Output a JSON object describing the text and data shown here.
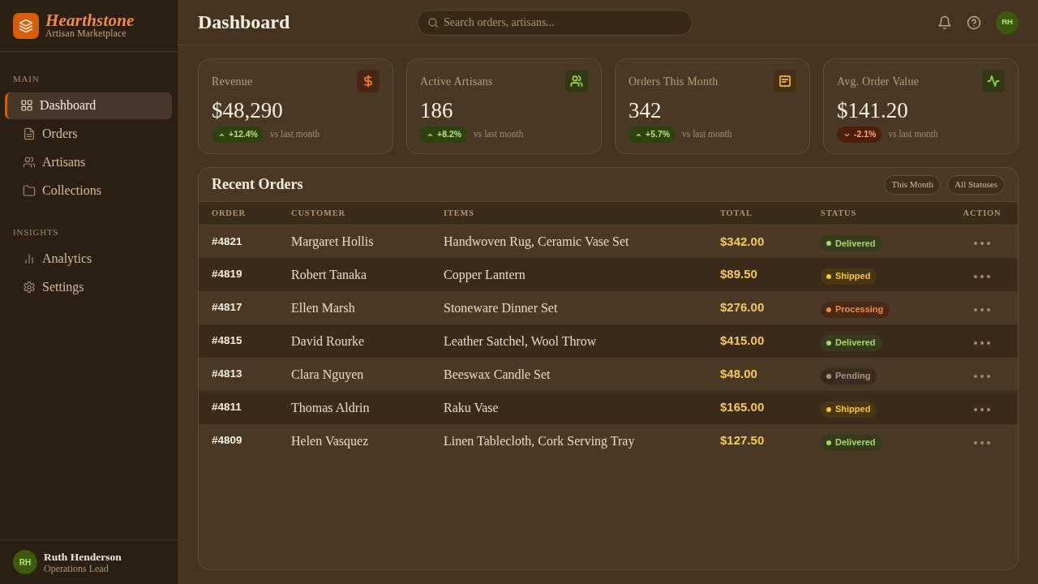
{
  "sidebar": {
    "brand": {
      "name": "Hearthstone",
      "tagline": "Artisan Marketplace"
    },
    "sections": [
      {
        "heading": "MAIN",
        "items": [
          {
            "label": "Dashboard",
            "selected": true
          },
          {
            "label": "Orders",
            "selected": false
          },
          {
            "label": "Artisans",
            "selected": false
          },
          {
            "label": "Collections",
            "selected": false
          }
        ]
      },
      {
        "heading": "INSIGHTS",
        "items": [
          {
            "label": "Analytics",
            "selected": false
          },
          {
            "label": "Settings",
            "selected": false
          }
        ]
      }
    ],
    "user": {
      "initials": "RH",
      "name": "Ruth Henderson",
      "role": "Operations Lead"
    }
  },
  "header": {
    "title": "Dashboard",
    "search": {
      "placeholder": "Search orders, artisans..."
    },
    "avatar": "RH"
  },
  "kpis": [
    {
      "label": "Revenue",
      "value": "$48,290",
      "color": "#e8783a",
      "trend": {
        "kind": "up",
        "text": "+12.4%"
      },
      "note": "vs last month"
    },
    {
      "label": "Active Artisans",
      "value": "186",
      "color": "#8fcf4a",
      "trend": {
        "kind": "up",
        "text": "+8.2%"
      },
      "note": "vs last month"
    },
    {
      "label": "Orders This Month",
      "value": "342",
      "color": "#e0a33a",
      "trend": {
        "kind": "up",
        "text": "+5.7%"
      },
      "note": "vs last month"
    },
    {
      "label": "Avg. Order Value",
      "value": "$141.20",
      "color": "#8fcf4a",
      "trend": {
        "kind": "down",
        "text": "-2.1%"
      },
      "note": "vs last month"
    }
  ],
  "orders": {
    "title": "Recent Orders",
    "filters": [
      "This Month",
      "All Statuses"
    ],
    "columns": [
      "ORDER",
      "CUSTOMER",
      "ITEMS",
      "TOTAL",
      "STATUS",
      "ACTION"
    ],
    "rows": [
      {
        "order": "#4821",
        "customer": "Margaret Hollis",
        "items": "Handwoven Rug, Ceramic Vase Set",
        "total": "$342.00",
        "status": {
          "label": "Delivered",
          "color": "#a8d86a"
        }
      },
      {
        "order": "#4819",
        "customer": "Robert Tanaka",
        "items": "Copper Lantern",
        "total": "$89.50",
        "status": {
          "label": "Shipped",
          "color": "#f5c242"
        }
      },
      {
        "order": "#4817",
        "customer": "Ellen Marsh",
        "items": "Stoneware Dinner Set",
        "total": "$276.00",
        "status": {
          "label": "Processing",
          "color": "#f08a4b"
        }
      },
      {
        "order": "#4815",
        "customer": "David Rourke",
        "items": "Leather Satchel, Wool Throw",
        "total": "$415.00",
        "status": {
          "label": "Delivered",
          "color": "#a8d86a"
        }
      },
      {
        "order": "#4813",
        "customer": "Clara Nguyen",
        "items": "Beeswax Candle Set",
        "total": "$48.00",
        "status": {
          "label": "Pending",
          "color": "#a8957e"
        }
      },
      {
        "order": "#4811",
        "customer": "Thomas Aldrin",
        "items": "Raku Vase",
        "total": "$165.00",
        "status": {
          "label": "Shipped",
          "color": "#f5c242"
        }
      },
      {
        "order": "#4809",
        "customer": "Helen Vasquez",
        "items": "Linen Tablecloth, Cork Serving Tray",
        "total": "$127.50",
        "status": {
          "label": "Delivered",
          "color": "#a8d86a"
        }
      }
    ]
  }
}
